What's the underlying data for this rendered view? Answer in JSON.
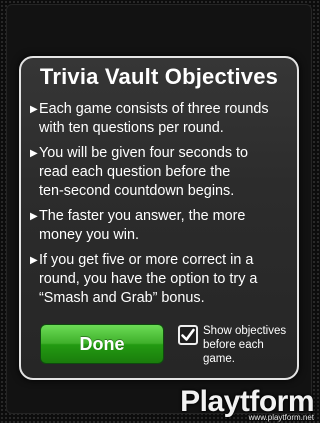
{
  "dialog": {
    "title": "Trivia Vault Objectives",
    "objectives": [
      {
        "line1": "Each game consists of three rounds",
        "line2": "with ten questions per round."
      },
      {
        "line1": "You will be given four seconds to",
        "line2": "read each question before the",
        "line3": "ten-second countdown begins."
      },
      {
        "line1": "The faster you answer, the more",
        "line2": "money you win."
      },
      {
        "line1": "If you get five or more correct in a",
        "line2": "round, you have the option to try a",
        "line3": "“Smash and Grab” bonus."
      }
    ],
    "bullet_glyph": "▶",
    "done_label": "Done",
    "show_objectives_label_line1": "Show objectives",
    "show_objectives_label_line2": "before each",
    "show_objectives_label_line3": "game.",
    "show_objectives_checked": true
  },
  "watermark": {
    "logo": "Playtform",
    "url": "www.playtform.net"
  },
  "colors": {
    "done_button": "#3fb02b",
    "dialog_border": "#e4e4e4",
    "background": "#0c0c0c"
  }
}
